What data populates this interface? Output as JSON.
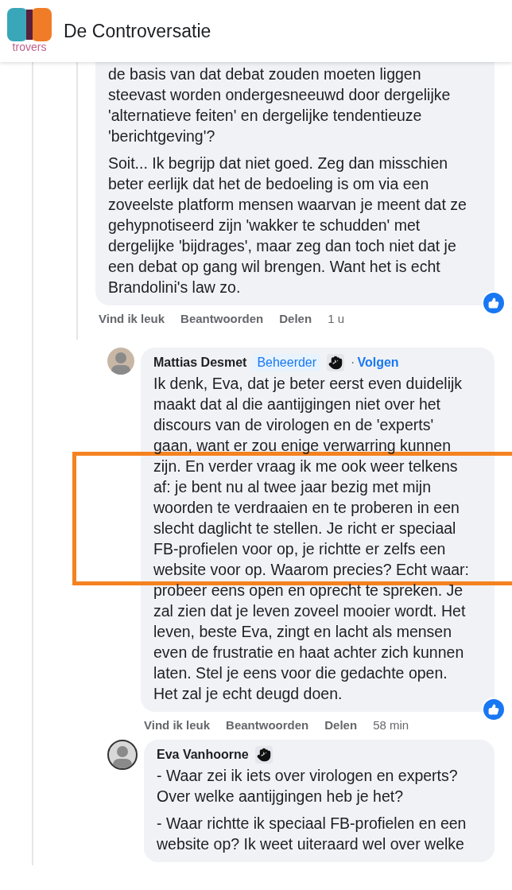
{
  "header": {
    "title": "De Controversatie",
    "logo_text": "trovers"
  },
  "comments": [
    {
      "paragraphs": [
        "de basis van dat debat zouden moeten liggen steevast worden ondergesneeuwd door dergelijke 'alternatieve feiten' en dergelijke tendentieuze 'berichtgeving'?",
        "Soit... Ik begrijp dat niet goed. Zeg dan misschien beter eerlijk dat het de bedoeling is om via een zoveelste platform mensen waarvan je meent dat ze gehypnotiseerd zijn 'wakker te schudden' met dergelijke 'bijdrages', maar zeg dan toch niet dat je een debat op gang wil brengen. Want het is echt Brandolini's law zo."
      ],
      "liked": true,
      "actions": [
        "Vind ik leuk",
        "Beantwoorden",
        "Delen"
      ],
      "time": "1 u"
    },
    {
      "author": "Mattias Desmet",
      "badge": "Beheerder",
      "separator": "·",
      "follow": "Volgen",
      "wave": true,
      "highlighted": true,
      "paragraphs": [
        "Ik denk, Eva, dat je beter eerst even duidelijk maakt dat al die aantijgingen niet over het discours van de virologen en de 'experts' gaan, want er zou enige verwarring kunnen zijn. En verder vraag ik me ook weer telkens af: je bent nu al twee jaar bezig met mijn woorden te verdraaien en te proberen in een slecht daglicht te stellen. Je richt er speciaal FB-profielen voor op, je richtte er zelfs een website voor op. Waarom precies? Echt waar: probeer eens open en oprecht te spreken. Je zal zien dat je leven zoveel mooier wordt. Het leven, beste Eva, zingt en lacht als mensen even de frustratie en haat achter zich kunnen laten. Stel je eens voor die gedachte open. Het zal je echt deugd doen."
      ],
      "liked": true,
      "actions": [
        "Vind ik leuk",
        "Beantwoorden",
        "Delen"
      ],
      "time": "58 min"
    },
    {
      "author": "Eva Vanhoorne",
      "wave": true,
      "paragraphs": [
        "- Waar zei ik iets over virologen en experts? Over welke aantijgingen heb je het?",
        "- Waar richtte ik speciaal FB-profielen en een website op? Ik weet uiteraard wel over welke"
      ]
    }
  ]
}
